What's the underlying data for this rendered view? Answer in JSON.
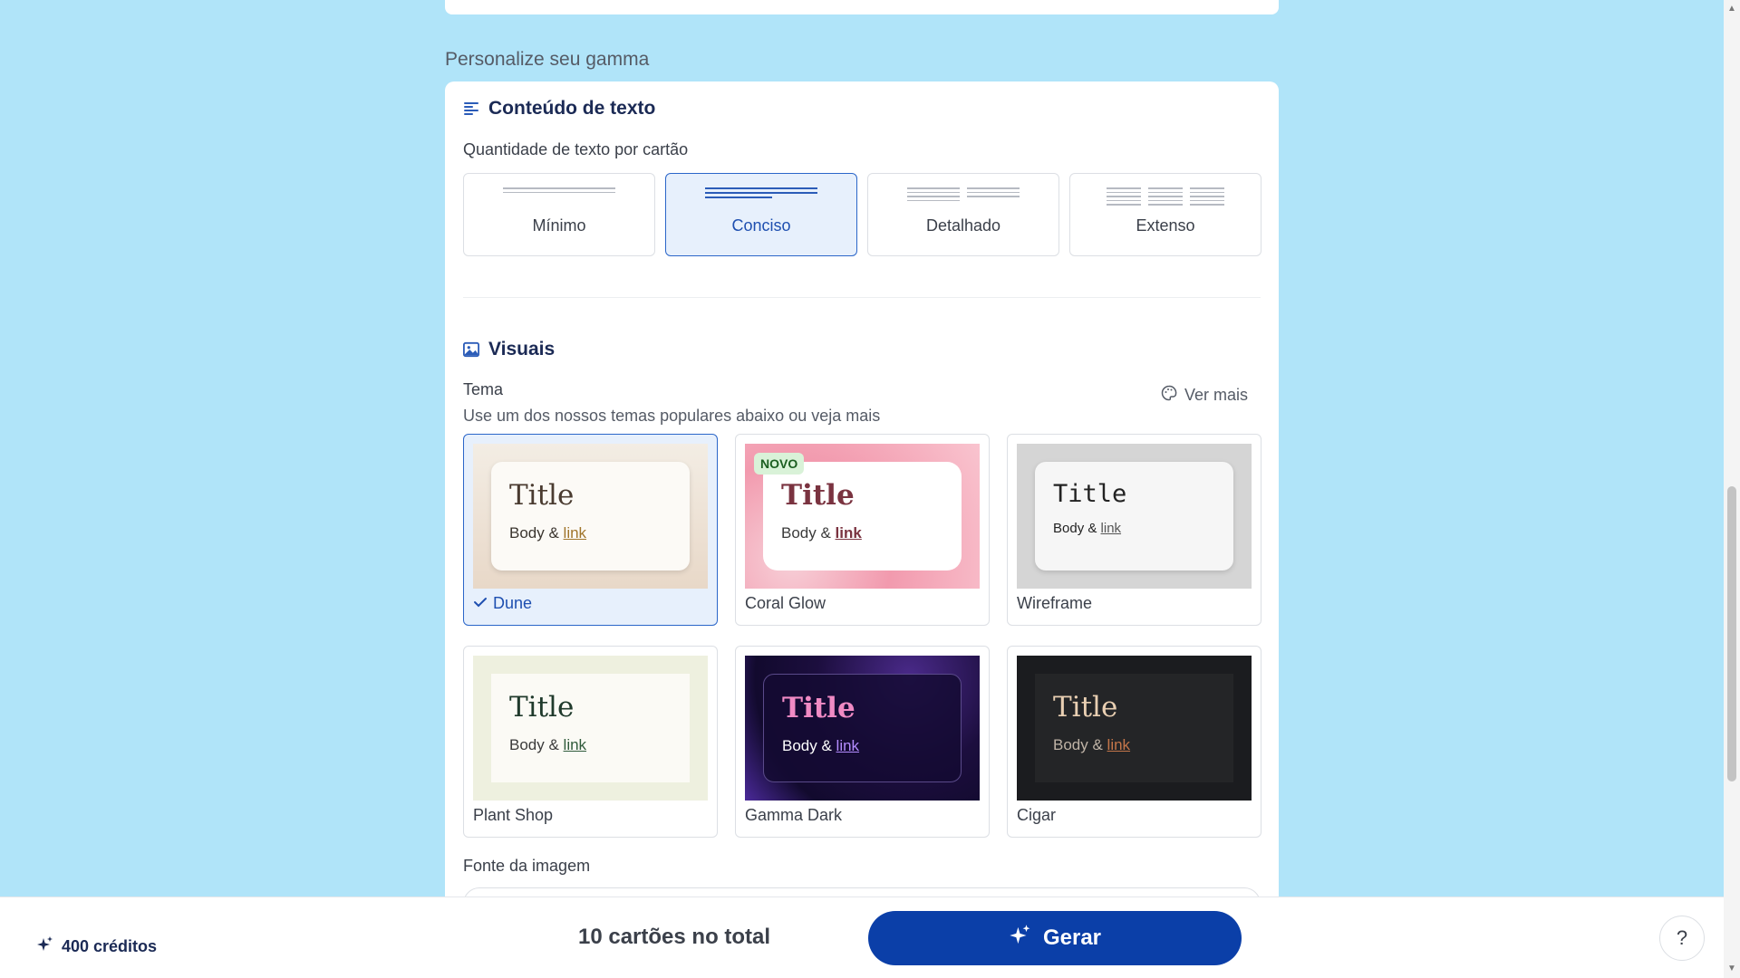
{
  "section": {
    "heading": "Personalize seu gamma"
  },
  "text_content": {
    "title": "Conteúdo de texto",
    "amount_label": "Quantidade de texto por cartão",
    "options": [
      {
        "label": "Mínimo",
        "selected": false
      },
      {
        "label": "Conciso",
        "selected": true
      },
      {
        "label": "Detalhado",
        "selected": false
      },
      {
        "label": "Extenso",
        "selected": false
      }
    ]
  },
  "visuals": {
    "title": "Visuais",
    "theme_label": "Tema",
    "theme_hint": "Use um dos nossos temas populares abaixo ou veja mais",
    "see_more": "Ver mais",
    "preview_text": {
      "title": "Title",
      "body": "Body & ",
      "link": "link"
    },
    "themes": [
      {
        "name": "Dune",
        "selected": true,
        "badge": "",
        "colors": {
          "bg": "#efe6dc",
          "card": "#fcfaf6",
          "title": "#4a3b30",
          "body": "#3b352f",
          "link": "#a0742a"
        }
      },
      {
        "name": "Coral Glow",
        "selected": false,
        "badge": "NOVO",
        "colors": {
          "bg": "#f4b4c0",
          "card": "#ffffff",
          "title": "#7a3340",
          "body": "#3b3b3b",
          "link": "#7a3340"
        }
      },
      {
        "name": "Wireframe",
        "selected": false,
        "badge": "",
        "colors": {
          "bg": "#d5d5d5",
          "card": "#f6f6f6",
          "title": "#222222",
          "body": "#222222",
          "link": "#555555"
        }
      },
      {
        "name": "Plant Shop",
        "selected": false,
        "badge": "",
        "colors": {
          "bg": "#eef0df",
          "card": "#fbfaf5",
          "title": "#203a2c",
          "body": "#3b3b3b",
          "link": "#2f5a3a"
        }
      },
      {
        "name": "Gamma Dark",
        "selected": false,
        "badge": "",
        "colors": {
          "bg": "#1c0e3e",
          "card": "#150a35",
          "title": "#f08ac4",
          "body": "#ffffff",
          "link": "#b48cff"
        }
      },
      {
        "name": "Cigar",
        "selected": false,
        "badge": "",
        "colors": {
          "bg": "#1b1c1f",
          "card": "#242527",
          "title": "#e9cfb2",
          "body": "#bfb3a6",
          "link": "#c4764a"
        }
      }
    ]
  },
  "image_source": {
    "label": "Fonte da imagem"
  },
  "footer": {
    "credits": "400 créditos",
    "total_cards": "10 cartões no total",
    "generate_label": "Gerar",
    "help_label": "?"
  },
  "colors": {
    "page_bg": "#b0e4f9",
    "accent": "#0b3fa8",
    "selected_bg": "#e7f0fc",
    "selected_border": "#2b66c9"
  }
}
